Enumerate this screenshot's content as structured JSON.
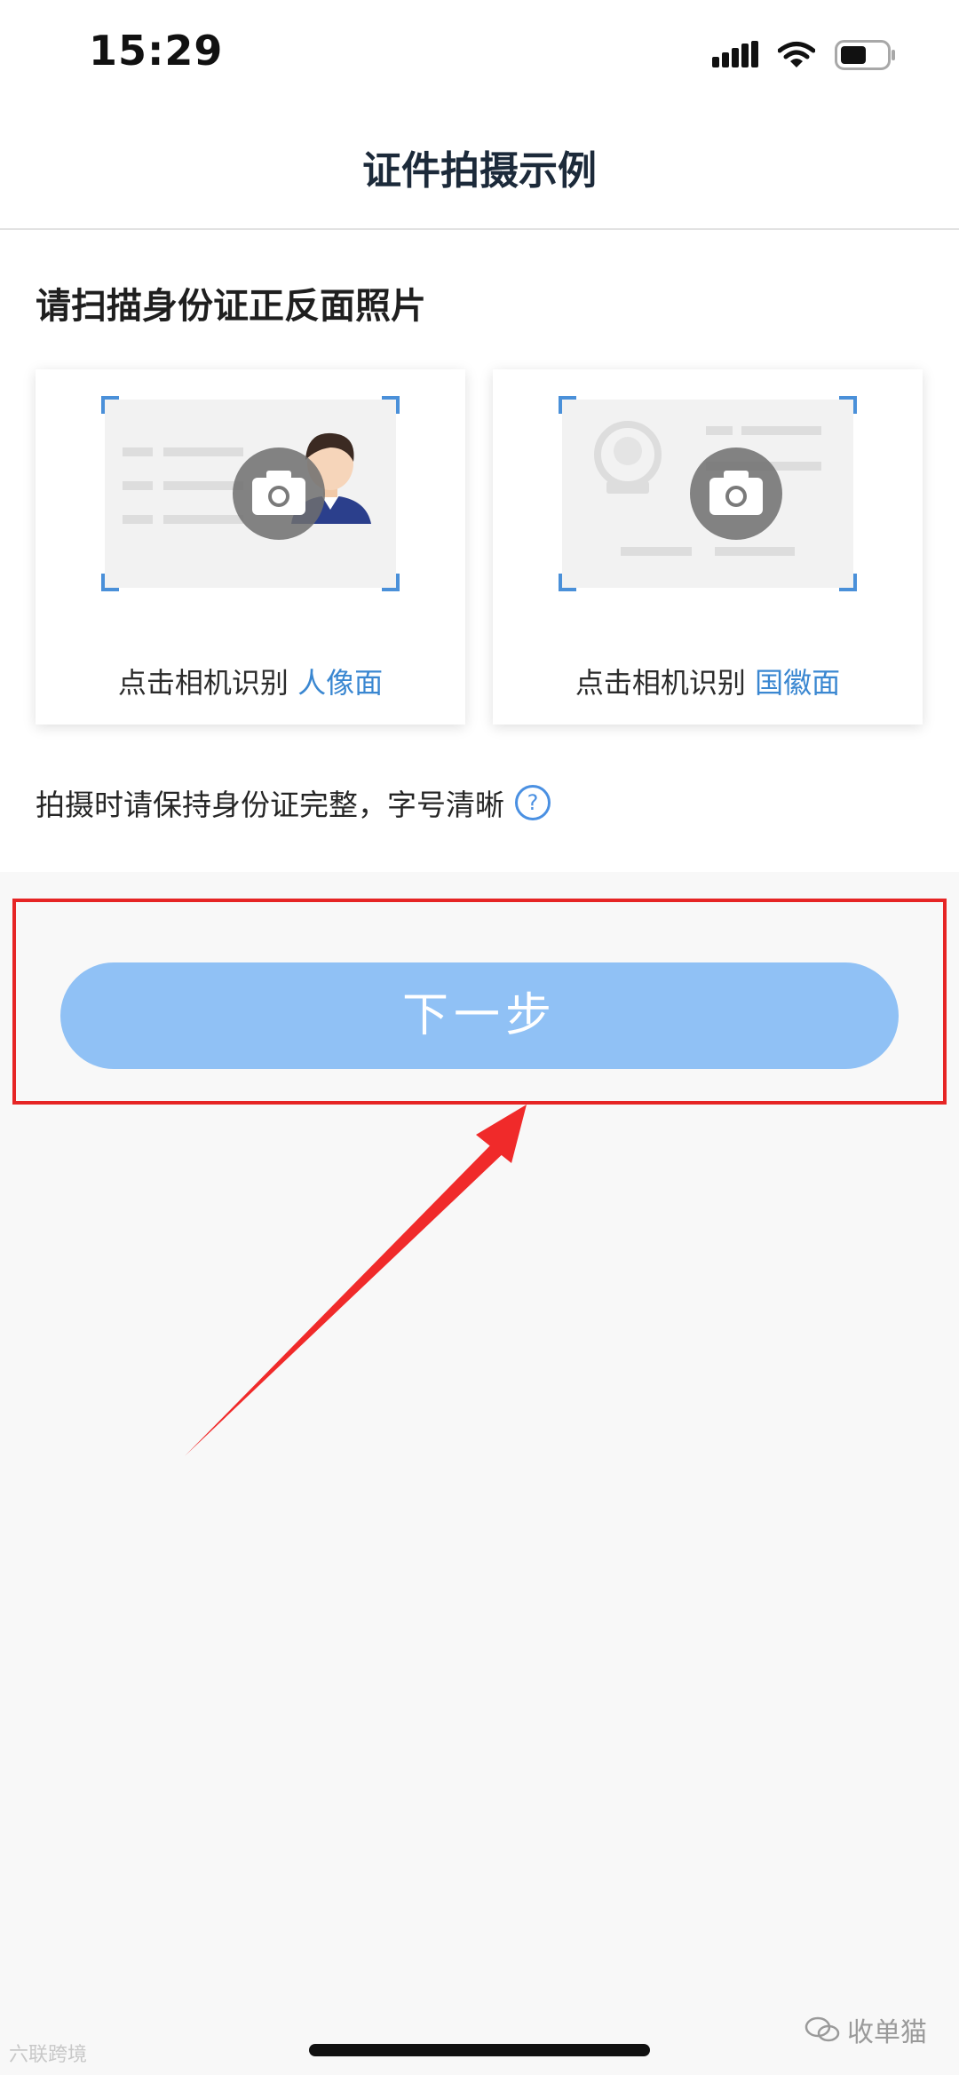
{
  "status_bar": {
    "time": "15:29"
  },
  "header": {
    "title": "证件拍摄示例"
  },
  "section": {
    "heading": "请扫描身份证正反面照片"
  },
  "cards": {
    "front": {
      "caption_prefix": "点击相机识别",
      "caption_highlight": "人像面"
    },
    "back": {
      "caption_prefix": "点击相机识别",
      "caption_highlight": "国徽面"
    }
  },
  "hint": {
    "text": "拍摄时请保持身份证完整，字号清晰",
    "help_symbol": "?"
  },
  "actions": {
    "next_label": "下一步"
  },
  "watermarks": {
    "left": "六联跨境",
    "right": "收单猫"
  },
  "colors": {
    "accent": "#3a87d1",
    "button": "#90c1f5",
    "annotation": "#e62525"
  }
}
